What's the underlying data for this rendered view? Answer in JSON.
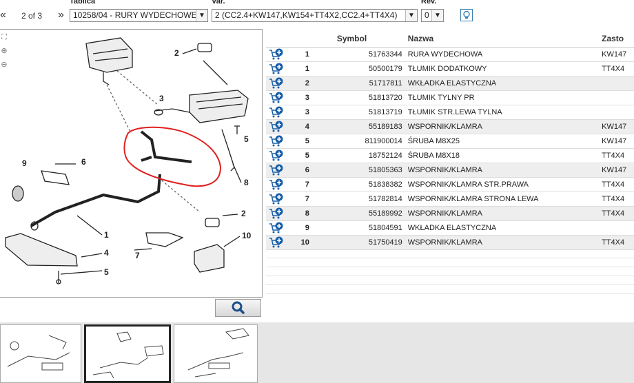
{
  "header": {
    "tablica_label": "Tablica",
    "var_label": "Var.",
    "rev_label": "Rev.",
    "prev_arrow": "«",
    "next_arrow": "»",
    "page_indicator": "2 of 3",
    "tablica_value": "10258/04 - RURY WYDECHOWE",
    "var_value": "2 (CC2.4+KW147,KW154+TT4X2,CC2.4+TT4X4)",
    "rev_value": "0"
  },
  "diagram": {
    "callouts": [
      "2",
      "3",
      "5",
      "8",
      "9",
      "6",
      "1",
      "2",
      "4",
      "5",
      "7",
      "10"
    ],
    "highlight_color": "#e02020"
  },
  "table": {
    "headers": {
      "symbol": "Symbol",
      "nazwa": "Nazwa",
      "zastosowanie": "Zasto"
    },
    "rows": [
      {
        "num": "1",
        "symbol": "51763344",
        "name": "RURA WYDECHOWA",
        "mod": "KW147"
      },
      {
        "num": "1",
        "symbol": "50500179",
        "name": "TŁUMIK DODATKOWY",
        "mod": "TT4X4"
      },
      {
        "num": "2",
        "symbol": "51717811",
        "name": "WKŁADKA ELASTYCZNA",
        "mod": ""
      },
      {
        "num": "3",
        "symbol": "51813720",
        "name": "TŁUMIK TYLNY PR",
        "mod": ""
      },
      {
        "num": "3",
        "symbol": "51813719",
        "name": "TŁUMIK STR.LEWA TYLNA",
        "mod": ""
      },
      {
        "num": "4",
        "symbol": "55189183",
        "name": "WSPORNIK/KLAMRA",
        "mod": "KW147"
      },
      {
        "num": "5",
        "symbol": "811900014",
        "name": "ŚRUBA M8X25",
        "mod": "KW147"
      },
      {
        "num": "5",
        "symbol": "18752124",
        "name": "ŚRUBA M8X18",
        "mod": "TT4X4"
      },
      {
        "num": "6",
        "symbol": "51805363",
        "name": "WSPORNIK/KLAMRA",
        "mod": "KW147"
      },
      {
        "num": "7",
        "symbol": "51838382",
        "name": "WSPORNIK/KLAMRA STR.PRAWA",
        "mod": "TT4X4"
      },
      {
        "num": "7",
        "symbol": "51782814",
        "name": "WSPORNIK/KLAMRA STRONA LEWA",
        "mod": "TT4X4"
      },
      {
        "num": "8",
        "symbol": "55189992",
        "name": "WSPORNIK/KLAMRA",
        "mod": "TT4X4"
      },
      {
        "num": "9",
        "symbol": "51804591",
        "name": "WKŁADKA ELASTYCZNA",
        "mod": ""
      },
      {
        "num": "10",
        "symbol": "51750419",
        "name": "WSPORNIK/KLAMRA",
        "mod": "TT4X4"
      }
    ]
  },
  "icons": {
    "cart": "add-to-cart-icon",
    "search": "search-icon",
    "bulb": "lightbulb-icon",
    "zoom_in": "zoom-in-icon",
    "zoom_out": "zoom-out-icon",
    "fit": "fit-icon"
  },
  "colors": {
    "cart_blue": "#1a5fa8",
    "row_shade": "#eeeeee",
    "bottom_bar": "#e6e6e6"
  }
}
